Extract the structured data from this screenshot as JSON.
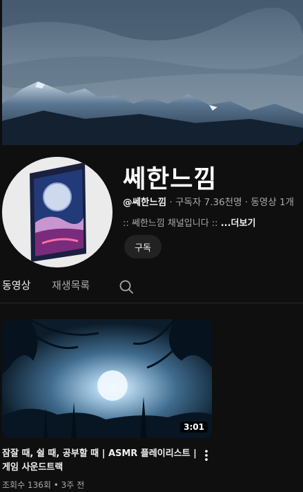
{
  "channel": {
    "name": "쎄한느낌",
    "handle": "@쎄한느낌",
    "separator": " · ",
    "subscribers": "구독자 7.36천명",
    "videos": "동영상 1개",
    "description": ":: 쎄한느낌 채널입니다 :: ",
    "more_label": "...더보기",
    "subscribe_label": "구독"
  },
  "tabs": [
    {
      "label": "동영상",
      "active": true
    },
    {
      "label": "재생목록",
      "active": false
    }
  ],
  "video": {
    "duration": "3:01",
    "title": "잠잘 때, 쉴 때, 공부할 때 | ASMR 플레이리스트 | 게임 사운드트랙",
    "views": "조회수 136회",
    "dot": " • ",
    "uploaded": "3주 전"
  },
  "colors": {
    "background": "#0f0f0f",
    "text": "#f1f1f1",
    "secondary_text": "#aaaaaa",
    "button_bg": "#222222"
  },
  "icons": {
    "search": "search-icon",
    "more": "more-vert-icon"
  }
}
